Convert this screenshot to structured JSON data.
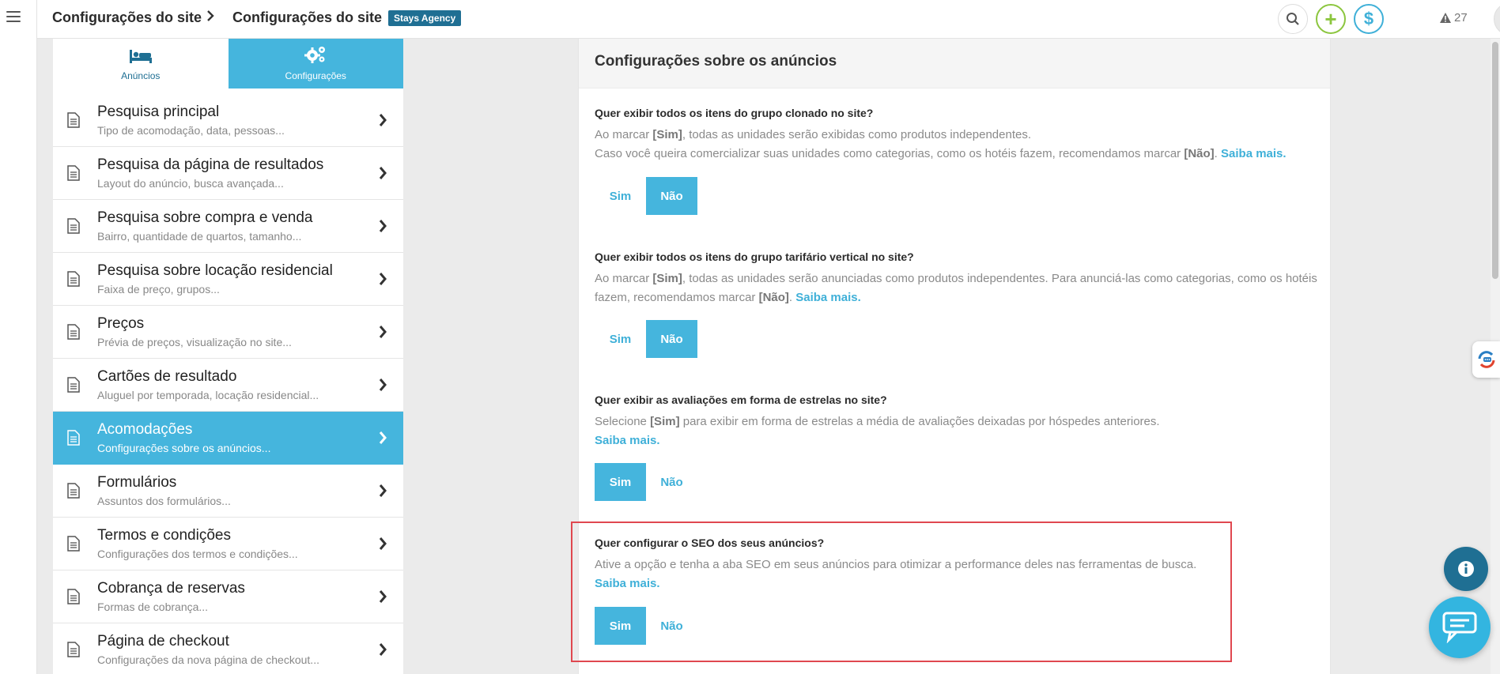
{
  "topbar": {
    "crumb_1": "Configurações do site",
    "crumb_2": "Configurações do site",
    "agency_badge": "Stays Agency",
    "alerts_count": "27"
  },
  "tabs": [
    {
      "label": "Anúncios",
      "icon": "bed-icon",
      "active": false
    },
    {
      "label": "Configurações",
      "icon": "gears-icon",
      "active": true
    }
  ],
  "menu": [
    {
      "title": "Pesquisa principal",
      "subtitle": "Tipo de acomodação, data, pessoas...",
      "active": false
    },
    {
      "title": "Pesquisa da página de resultados",
      "subtitle": "Layout do anúncio, busca avançada...",
      "active": false
    },
    {
      "title": "Pesquisa sobre compra e venda",
      "subtitle": "Bairro, quantidade de quartos, tamanho...",
      "active": false
    },
    {
      "title": "Pesquisa sobre locação residencial",
      "subtitle": "Faixa de preço, grupos...",
      "active": false
    },
    {
      "title": "Preços",
      "subtitle": "Prévia de preços, visualização no site...",
      "active": false
    },
    {
      "title": "Cartões de resultado",
      "subtitle": "Aluguel por temporada, locação residencial...",
      "active": false
    },
    {
      "title": "Acomodações",
      "subtitle": "Configurações sobre os anúncios...",
      "active": true
    },
    {
      "title": "Formulários",
      "subtitle": "Assuntos dos formulários...",
      "active": false
    },
    {
      "title": "Termos e condições",
      "subtitle": "Configurações dos termos e condições...",
      "active": false
    },
    {
      "title": "Cobrança de reservas",
      "subtitle": "Formas de cobrança...",
      "active": false
    },
    {
      "title": "Página de checkout",
      "subtitle": "Configurações da nova página de checkout...",
      "active": false
    }
  ],
  "content": {
    "header": "Configurações sobre os anúncios",
    "q1": {
      "title": "Quer exibir todos os itens do grupo clonado no site?",
      "desc_a": "Ao marcar ",
      "desc_b": "[Sim]",
      "desc_c": ", todas as unidades serão exibidas como produtos independentes.",
      "desc_d": "Caso você queira comercializar suas unidades como categorias, como os hotéis fazem, recomendamos marcar ",
      "desc_e": "[Não]",
      "desc_f": ". ",
      "link": "Saiba mais.",
      "yes": "Sim",
      "no": "Não",
      "selected": "no"
    },
    "q2": {
      "title": "Quer exibir todos os itens do grupo tarifário vertical no site?",
      "desc_a": "Ao marcar ",
      "desc_b": "[Sim]",
      "desc_c": ", todas as unidades serão anunciadas como produtos independentes. Para anunciá-las como categorias, como os hotéis fazem, recomendamos marcar ",
      "desc_d": "[Não]",
      "desc_e": ". ",
      "link": "Saiba mais.",
      "yes": "Sim",
      "no": "Não",
      "selected": "no"
    },
    "q3": {
      "title": "Quer exibir as avaliações em forma de estrelas no site?",
      "desc_a": "Selecione ",
      "desc_b": "[Sim]",
      "desc_c": " para exibir em forma de estrelas a média de avaliações deixadas por hóspedes anteriores.",
      "link": "Saiba mais.",
      "yes": "Sim",
      "no": "Não",
      "selected": "yes"
    },
    "q4": {
      "title": "Quer configurar o SEO dos seus anúncios?",
      "desc": "Ative a opção e tenha a aba SEO em seus anúncios para otimizar a performance deles nas ferramentas de busca.",
      "link": "Saiba mais.",
      "yes": "Sim",
      "no": "Não",
      "selected": "yes"
    }
  },
  "colors": {
    "accent": "#45b5dd",
    "dark_blue": "#1f6f93",
    "highlight_border": "#e04850",
    "plus_green": "#8cc63f"
  }
}
